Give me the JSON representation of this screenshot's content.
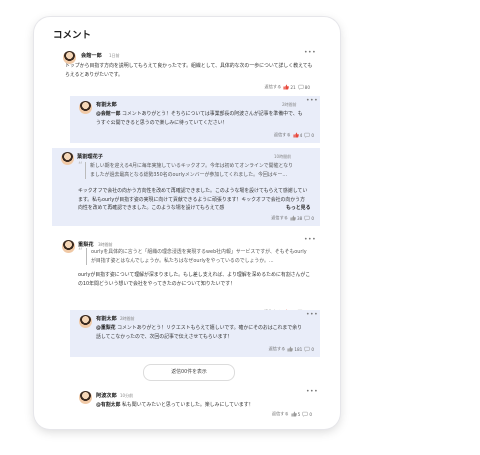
{
  "section_title": "コメント",
  "comments": [
    {
      "name": "会館一郎",
      "time": "1日前",
      "body": "トップから目指す方向を説明してもらえて良かったです。組織として、具体的な次の一歩について詳しく教えてもらえるとありがたいです。",
      "reply_label": "返信する",
      "likes": "21",
      "comments": "80"
    },
    {
      "name": "有割太郎",
      "time": "2時間前",
      "mention": "@会館一郎",
      "body": " コメントありがとう！そちらについては事業部長の阿波さんが記事を準備中で、もうすぐ公開できると思うので楽しみに待っていてください！",
      "reply_label": "返信する",
      "likes": "4",
      "comments": "0"
    },
    {
      "name": "葉割理花子",
      "time": "10時間前",
      "quote": "新しい期を迎える4月に毎年実施しているキックオフ。今年は初めてオンラインで開催となりましたが過去最高となる総勢350名のourlyメンバーが参加してくれました。今回はキー...",
      "body": "キックオフで会社の向かう方向性を改めて再確認できました。このような場を設けてもらえて感謝しています。私もourlyが目指す姿の実現に向けて貢献できるように頑張ります！キックオフで会社の向かう方向性を改めて再確認できました。このような場を設けてもらえて感",
      "see_more": "もっと見る",
      "reply_label": "返信する",
      "likes": "38",
      "comments": "0"
    },
    {
      "name": "重梨花",
      "time": "3時間前",
      "quote": "ourlyを具体的に言うと「組織の理念浸透を実現するweb社内報」サービスですが、そもそもourlyが目指す姿とはなんでしょうか。私たちはなぜourlyをやっているのでしょうか。...",
      "body": "ourlyが目指す姿について理解が深まりました。もし差し支えれば、より理解を深めるために有割さんがこの10年間どういう想いで会社をやってきたのかについて知りたいです！",
      "reply_label": "返信する",
      "likes": "21",
      "comments": "100"
    },
    {
      "name": "有割太郎",
      "time": "2時間前",
      "mention": "@重梨花",
      "body": " コメントありがとう！リクエストもらえて嬉しいです。確かにそのおはこれまで余り話してこなかったので、次回の記事で伝えさせてもらいます！",
      "reply_label": "返信する",
      "likes": "181",
      "comments": "0"
    },
    {
      "name": "阿波次郎",
      "time": "10分前",
      "mention": "@有割太郎",
      "body": " 私も聞いてみたいと思っていました。楽しみにしています！",
      "reply_label": "返信する",
      "likes": "5",
      "comments": "0"
    }
  ],
  "load_more": "返信00件を表示",
  "colors": {
    "reply_bg": "#e9edf9",
    "like_active": "#e8473a",
    "like_idle": "#999999"
  },
  "icons": {
    "more": "more-horizontal-icon",
    "like": "thumbs-up-icon",
    "comment": "comment-bubble-icon",
    "quote": "quote-icon"
  }
}
